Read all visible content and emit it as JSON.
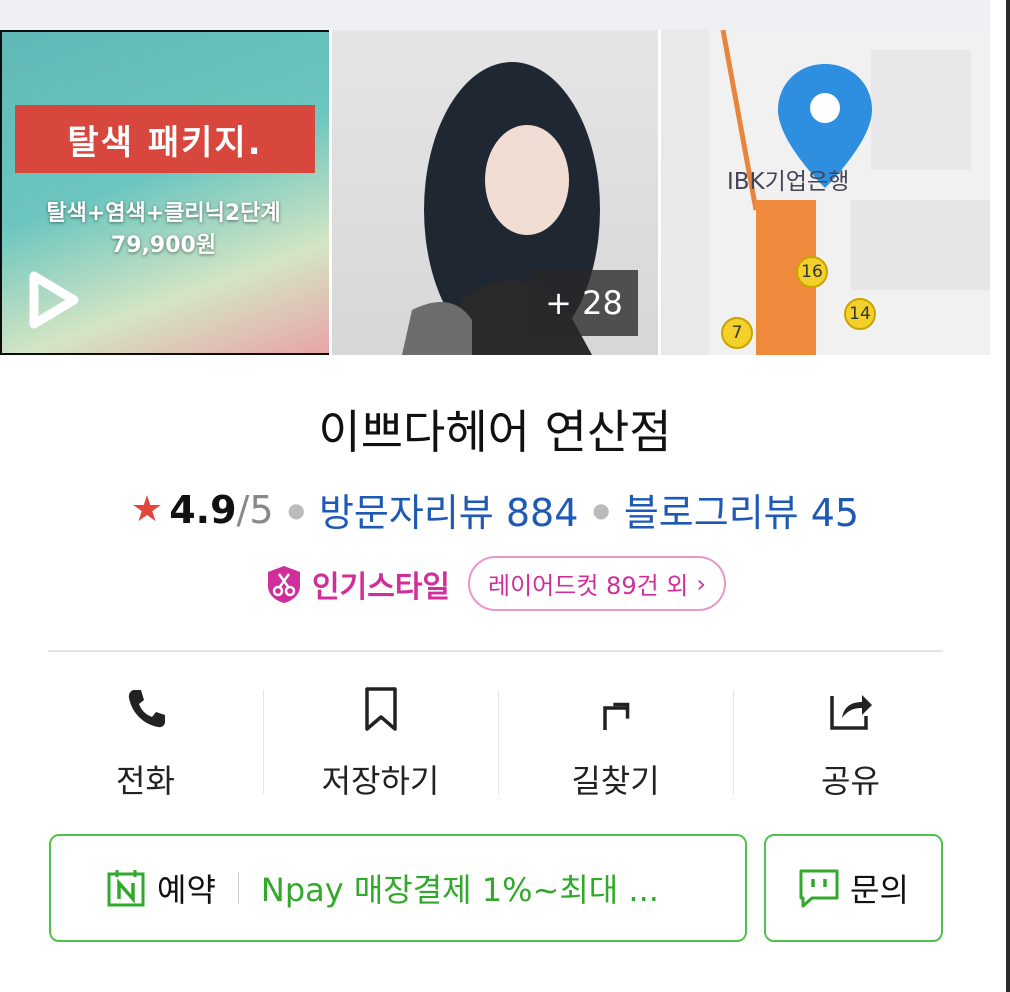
{
  "gallery": {
    "video": {
      "banner": "탈색 패키지.",
      "subtitle": "탈색+염색+클리닉2단계",
      "price": "79,900원"
    },
    "photo": {
      "more_count": "+ 28"
    },
    "map": {
      "bank_label": "IBK기업은행",
      "stops": [
        "16",
        "14",
        "7"
      ]
    }
  },
  "place": {
    "name": "이쁘다헤어 연산점",
    "rating": "4.9",
    "rating_max": "/5",
    "visitor_reviews": "방문자리뷰 884",
    "blog_reviews": "블로그리뷰 45"
  },
  "popular_style": {
    "label": "인기스타일",
    "tag": "레이어드컷 89건 외",
    "chevron": "›"
  },
  "actions": [
    {
      "label": "전화",
      "icon": "phone-icon"
    },
    {
      "label": "저장하기",
      "icon": "bookmark-icon"
    },
    {
      "label": "길찾기",
      "icon": "directions-icon"
    },
    {
      "label": "공유",
      "icon": "share-icon"
    }
  ],
  "buttons": {
    "reserve_label": "예약",
    "reserve_promo": "Npay 매장결제 1%~최대 ...",
    "ask_label": "문의"
  },
  "colors": {
    "link": "#1e5ab5",
    "accent_pink": "#d02e9a",
    "naver_green": "#52c24b",
    "star_red": "#e1473d"
  }
}
